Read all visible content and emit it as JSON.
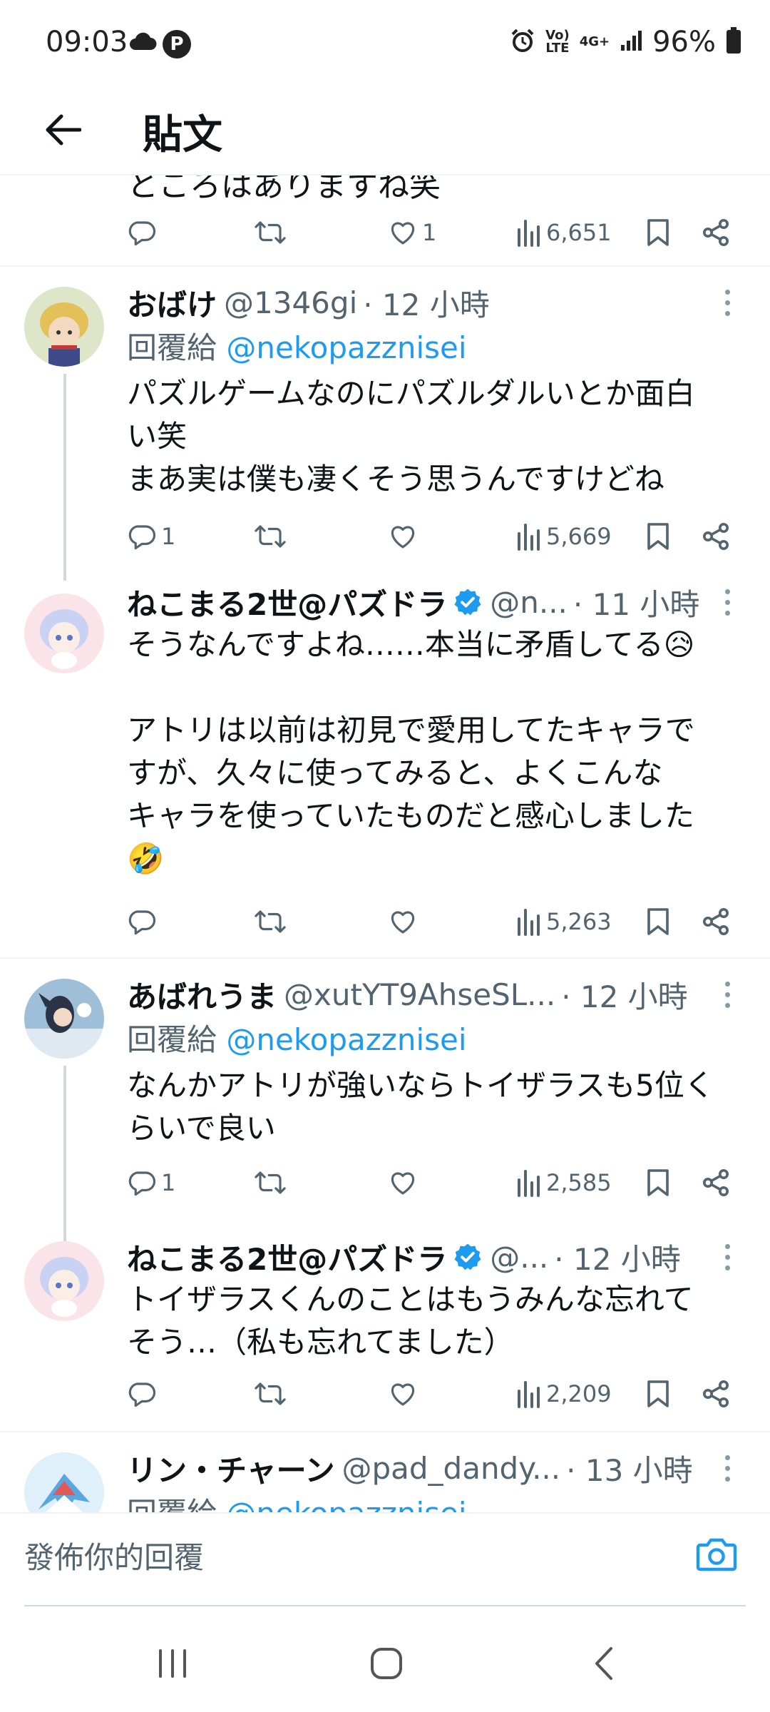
{
  "status": {
    "time": "09:03",
    "volte": "Vo)\nLTE",
    "network": "4G+",
    "battery": "96%"
  },
  "header": {
    "title": "貼文"
  },
  "partial_post": {
    "text": "ところはありますね笑",
    "likes": "1",
    "views": "6,651"
  },
  "posts": [
    {
      "name": "おばけ",
      "handle": "@1346gi",
      "time": "· 12 小時",
      "reply_prefix": "回覆給",
      "reply_mention": "@nekopazznisei",
      "text": "パズルゲームなのにパズルダルいとか面白\nい笑\nまあ実は僕も凄くそう思うんですけどね",
      "replies": "1",
      "views": "5,669"
    },
    {
      "name": "ねこまる2世@パズドラ",
      "handle": "@n...",
      "time": "· 11 小時",
      "text": "そうなんですよね……本当に矛盾してる😥\n\nアトリは以前は初見で愛用してたキャラで\nすが、久々に使ってみると、よくこんな\nキャラを使っていたものだと感心しました\n🤣",
      "views": "5,263"
    },
    {
      "name": "あばれうま",
      "handle": "@xutYT9AhseSL...",
      "time": "· 12 小時",
      "reply_prefix": "回覆給",
      "reply_mention": "@nekopazznisei",
      "text": "なんかアトリが強いならトイザラスも5位く\nらいで良い",
      "replies": "1",
      "views": "2,585"
    },
    {
      "name": "ねこまる2世@パズドラ",
      "handle": "@...",
      "time": "· 12 小時",
      "text": "トイザラスくんのことはもうみんな忘れて\nそう…（私も忘れてました）",
      "views": "2,209"
    },
    {
      "name": "リン・チャーン",
      "handle": "@pad_dandy...",
      "time": "· 13 小時",
      "reply_prefix": "回覆給",
      "reply_mention": "@nekopazznisei"
    }
  ],
  "reply_bar": {
    "placeholder": "發佈你的回覆"
  },
  "colors": {
    "accent": "#1d9bf0",
    "muted": "#536471",
    "text": "#0f1419"
  }
}
